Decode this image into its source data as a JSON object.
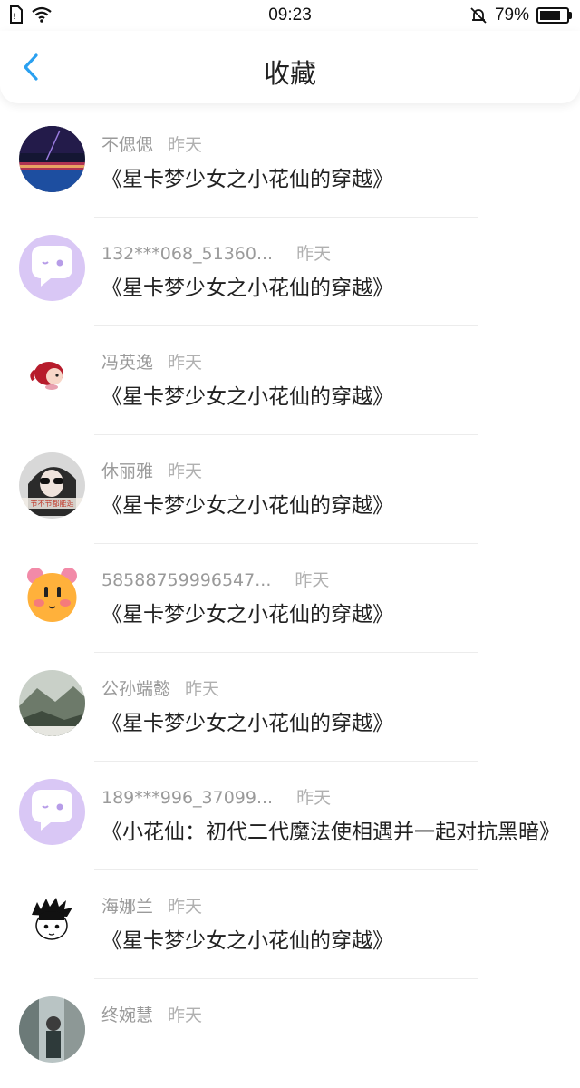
{
  "status_bar": {
    "time": "09:23",
    "battery": "79%",
    "battery_level": 0.79
  },
  "header": {
    "title": "收藏"
  },
  "items": [
    {
      "user": "不偲偲",
      "time": "昨天",
      "title": "《星卡梦少女之小花仙的穿越》",
      "avatar": "night-scene-avatar"
    },
    {
      "user": "132***068_51360...",
      "time": "昨天",
      "title": "《星卡梦少女之小花仙的穿越》",
      "avatar": "default-chat-avatar"
    },
    {
      "user": "冯英逸",
      "time": "昨天",
      "title": "《星卡梦少女之小花仙的穿越》",
      "avatar": "cartoon-girl-avatar"
    },
    {
      "user": "休丽雅",
      "time": "昨天",
      "title": "《星卡梦少女之小花仙的穿越》",
      "avatar": "photo-sunglasses-avatar",
      "avatar_caption": "节不节都能逛"
    },
    {
      "user": "58588759996547...",
      "time": "昨天",
      "title": "《星卡梦少女之小花仙的穿越》",
      "avatar": "cartoon-pig-avatar"
    },
    {
      "user": "公孙端懿",
      "time": "昨天",
      "title": "《星卡梦少女之小花仙的穿越》",
      "avatar": "landscape-avatar"
    },
    {
      "user": "189***996_37099...",
      "time": "昨天",
      "title": "《小花仙：初代二代魔法使相遇并一起对抗黑暗》",
      "avatar": "default-chat-avatar"
    },
    {
      "user": "海娜兰",
      "time": "昨天",
      "title": "《星卡梦少女之小花仙的穿越》",
      "avatar": "sketch-boy-avatar"
    },
    {
      "user": "终婉慧",
      "time": "昨天",
      "title": "",
      "avatar": "street-photo-avatar"
    }
  ],
  "colors": {
    "accent": "#2aa0f0",
    "chat_avatar_bg": "#d9c7f5"
  }
}
